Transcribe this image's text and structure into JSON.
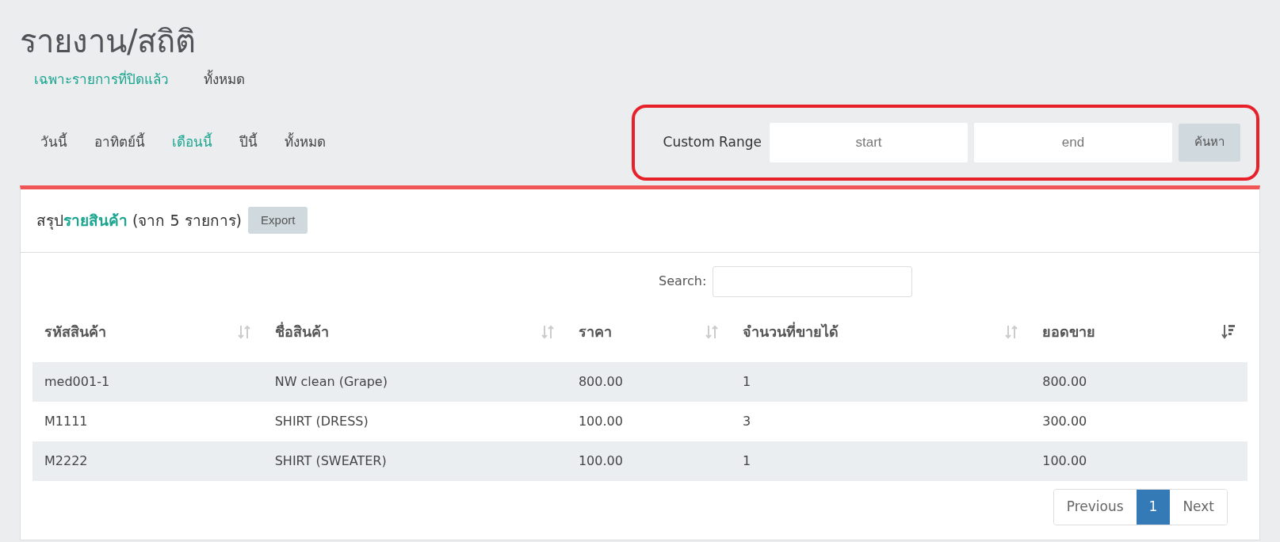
{
  "page_title": "รายงาน/สถิติ",
  "status_filters": [
    {
      "label": "เฉพาะรายการที่ปิดแล้ว",
      "selected": true
    },
    {
      "label": "ทั้งหมด",
      "selected": false
    }
  ],
  "period_tabs": [
    {
      "label": "วันนี้",
      "selected": false
    },
    {
      "label": "อาทิตย์นี้",
      "selected": false
    },
    {
      "label": "เดือนนี้",
      "selected": true
    },
    {
      "label": "ปีนี้",
      "selected": false
    },
    {
      "label": "ทั้งหมด",
      "selected": false
    }
  ],
  "custom_range": {
    "label": "Custom Range",
    "start": {
      "placeholder": "start"
    },
    "end": {
      "placeholder": "end"
    },
    "button": "ค้นหา",
    "highlighted": true
  },
  "panel": {
    "heading": "สรุป**รายสินค้า** (จาก 5 รายการ)",
    "export_button": "Export",
    "search": {
      "label": "Search:"
    },
    "table": {
      "columns": [
        {
          "label": "รหัสสินค้า",
          "sorted_desc": false
        },
        {
          "label": "ชื่อสินค้า",
          "sorted_desc": false
        },
        {
          "label": "ราคา",
          "sorted_desc": false
        },
        {
          "label": "จำนวนที่ขายได้",
          "sorted_desc": false
        },
        {
          "label": "ยอดขาย",
          "sorted_desc": true
        }
      ],
      "rows": [
        [
          "med001-1",
          "NW clean (Grape)",
          "800.00",
          "1",
          "800.00"
        ],
        [
          "M1111",
          "SHIRT (DRESS)",
          "100.00",
          "3",
          "300.00"
        ],
        [
          "M2222",
          "SHIRT (SWEATER)",
          "100.00",
          "1",
          "100.00"
        ]
      ]
    },
    "pagination": [
      {
        "label": "Previous",
        "selected": false
      },
      {
        "label": "1",
        "selected": true
      },
      {
        "label": "Next",
        "selected": false
      }
    ]
  }
}
